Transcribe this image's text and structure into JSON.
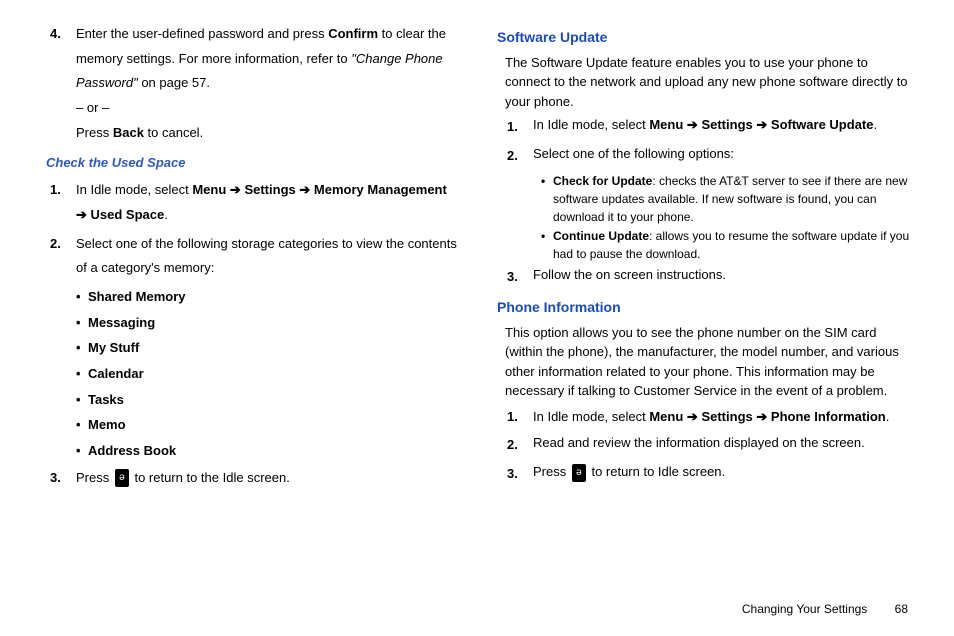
{
  "left": {
    "step4_a": "Enter the user-defined password and press ",
    "step4_b": "Confirm",
    "step4_c": " to clear the memory settings. For more information, refer to ",
    "step4_ref": "\"Change Phone Password\"",
    "step4_d": "  on page 57.",
    "or": "– or –",
    "step4_e1": "Press ",
    "step4_e2": "Back",
    "step4_e3": " to cancel.",
    "check_heading": "Check the Used Space",
    "c1_a": "In Idle mode, select ",
    "c1_menu": "Menu",
    "c1_settings": "Settings",
    "c1_memmgmt": "Memory Management",
    "c1_used": "Used Space",
    "c2": "Select one of the following storage categories to view the contents of a category's memory:",
    "bul1": "Shared Memory",
    "bul2": "Messaging",
    "bul3": "My Stuff",
    "bul4": "Calendar",
    "bul5": "Tasks",
    "bul6": "Memo",
    "bul7": "Address Book",
    "c3_a": "Press ",
    "c3_b": " to return to the Idle screen."
  },
  "right": {
    "su_heading": "Software Update",
    "su_para": "The Software Update feature enables you to use your phone to connect to the network and upload any new phone software directly to your phone.",
    "su1_a": "In Idle mode, select ",
    "su1_menu": "Menu",
    "su1_settings": "Settings",
    "su1_sw": "Software Update",
    "su2": "Select one of the following options:",
    "sub1_b": "Check for Update",
    "sub1_t": ": checks the AT&T server to see if there are new software updates available. If new software is found, you can download it to your phone.",
    "sub2_b": "Continue Update",
    "sub2_t": ": allows you to resume the software update if you had to pause the download.",
    "su3": "Follow the on screen instructions.",
    "pi_heading": "Phone Information",
    "pi_para": "This option allows you to see the phone number on the SIM card (within the phone), the manufacturer, the model number, and various other information related to your phone. This information may be necessary if talking to Customer Service in the event of a problem.",
    "pi1_a": "In Idle mode, select ",
    "pi1_menu": "Menu",
    "pi1_settings": "Settings",
    "pi1_phone": "Phone Information",
    "pi2": "Read and review the information displayed on the screen.",
    "pi3_a": "Press ",
    "pi3_b": " to return to Idle screen."
  },
  "arrow": "➔",
  "footer": {
    "section": "Changing Your Settings",
    "page": "68"
  },
  "nums": {
    "n1": "1.",
    "n2": "2.",
    "n3": "3.",
    "n4": "4."
  },
  "key_glyph": "ə"
}
